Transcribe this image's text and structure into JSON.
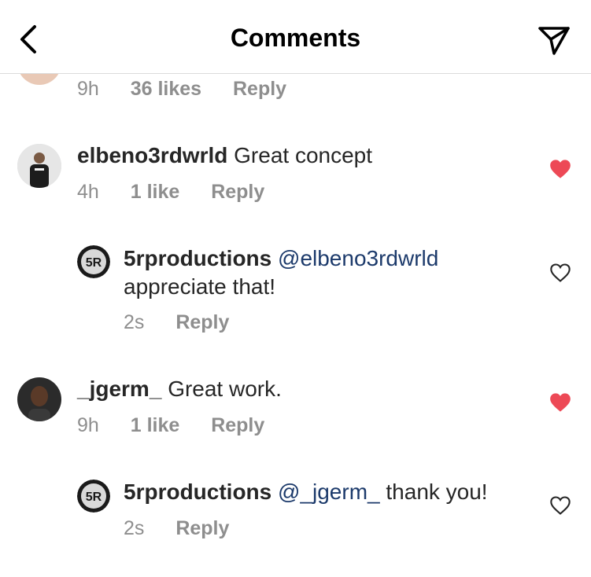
{
  "header": {
    "title": "Comments"
  },
  "comments": [
    {
      "id": "top-partial",
      "time": "9h",
      "likes": "36 likes",
      "reply": "Reply"
    },
    {
      "id": "c1",
      "username": "elbeno3rdwrld",
      "text": "Great concept",
      "time": "4h",
      "likes": "1 like",
      "reply": "Reply",
      "liked": true
    },
    {
      "id": "r1",
      "username": "5rproductions",
      "mention": "@elbeno3rdwrld",
      "text": "appreciate that!",
      "time": "2s",
      "reply": "Reply",
      "liked": false
    },
    {
      "id": "c2",
      "username": "_jgerm_",
      "text": "Great work.",
      "time": "9h",
      "likes": "1 like",
      "reply": "Reply",
      "liked": true
    },
    {
      "id": "r2",
      "username": "5rproductions",
      "mention": "@_jgerm_",
      "text": "thank you!",
      "time": "2s",
      "reply": "Reply",
      "liked": false
    }
  ],
  "colors": {
    "heart_liked": "#ed4956",
    "mention": "#1c3a6b",
    "meta": "#8e8e8e"
  },
  "icons": {
    "back": "chevron-left-icon",
    "share": "paper-plane-icon",
    "like": "heart-icon"
  }
}
